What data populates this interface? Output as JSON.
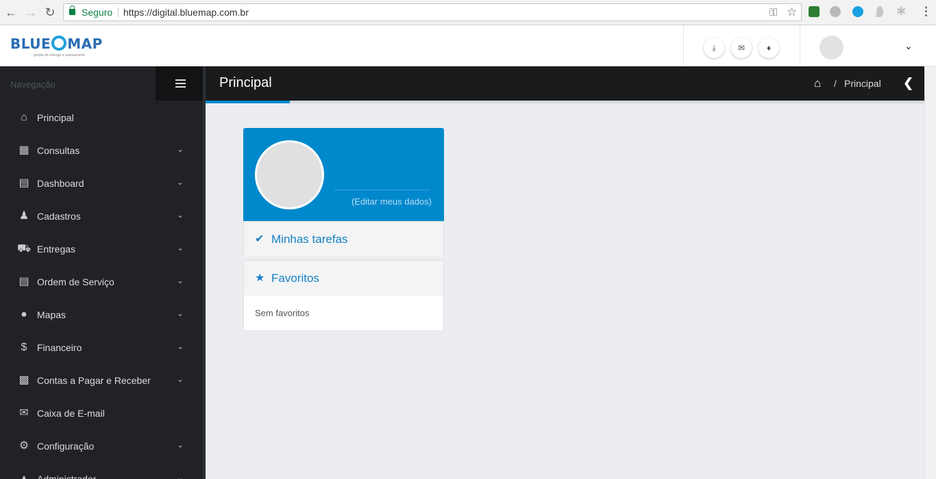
{
  "browser": {
    "secure_label": "Seguro",
    "url": "https://digital.bluemap.com.br"
  },
  "header": {
    "logo_text_left": "BLUE",
    "logo_text_right": "MAP",
    "logo_tagline": "gestão de entrega e rastreamento"
  },
  "sidebar": {
    "header": "Navegação",
    "items": [
      {
        "label": "Principal",
        "icon": "home-icon",
        "has_chevron": false
      },
      {
        "label": "Consultas",
        "icon": "calendar-icon",
        "has_chevron": true
      },
      {
        "label": "Dashboard",
        "icon": "bar-chart-icon",
        "has_chevron": true
      },
      {
        "label": "Cadastros",
        "icon": "person-icon",
        "has_chevron": true
      },
      {
        "label": "Entregas",
        "icon": "truck-icon",
        "has_chevron": true
      },
      {
        "label": "Ordem de Serviço",
        "icon": "document-icon",
        "has_chevron": true
      },
      {
        "label": "Mapas",
        "icon": "map-marker-icon",
        "has_chevron": true
      },
      {
        "label": "Financeiro",
        "icon": "dollar-icon",
        "has_chevron": true
      },
      {
        "label": "Contas a Pagar e Receber",
        "icon": "money-icon",
        "has_chevron": true
      },
      {
        "label": "Caixa de E-mail",
        "icon": "envelope-icon",
        "has_chevron": false
      },
      {
        "label": "Configuração",
        "icon": "gears-icon",
        "has_chevron": true
      },
      {
        "label": "Administrador",
        "icon": "bank-icon",
        "has_chevron": true
      }
    ]
  },
  "page": {
    "title": "Principal",
    "breadcrumb_sep": "/",
    "breadcrumb_current": "Principal"
  },
  "profile": {
    "edit_link": "(Editar meus dados)"
  },
  "tasks": {
    "title": "Minhas tarefas"
  },
  "favorites": {
    "title": "Favoritos",
    "empty_text": "Sem favoritos"
  },
  "colors": {
    "accent": "#0088cc",
    "sidebar_bg": "#202226",
    "title_bar_bg": "#1a1b1d",
    "content_bg": "#ebedf0"
  }
}
